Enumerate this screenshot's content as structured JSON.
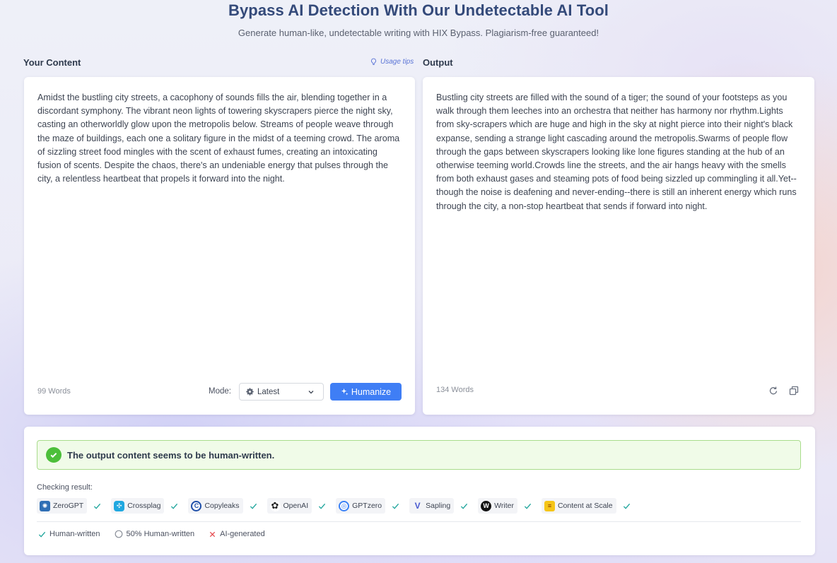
{
  "header": {
    "title": "Bypass AI Detection With Our Undetectable AI Tool",
    "subtitle": "Generate human-like, undetectable writing with HIX Bypass. Plagiarism-free guaranteed!"
  },
  "input": {
    "label": "Your Content",
    "usage_tips": "Usage tips",
    "text": "Amidst the bustling city streets, a cacophony of sounds fills the air, blending together in a discordant symphony. The vibrant neon lights of towering skyscrapers pierce the night sky, casting an otherworldly glow upon the metropolis below. Streams of people weave through the maze of buildings, each one a solitary figure in the midst of a teeming crowd. The aroma of sizzling street food mingles with the scent of exhaust fumes, creating an intoxicating fusion of scents. Despite the chaos, there's an undeniable energy that pulses through the city, a relentless heartbeat that propels it forward into the night.",
    "word_count": "99 Words",
    "mode_label": "Mode:",
    "mode_value": "Latest",
    "humanize_label": "Humanize"
  },
  "output": {
    "label": "Output",
    "text": "Bustling city streets are filled with the sound of a tiger; the sound of your footsteps as you walk through them leeches into an orchestra that neither has harmony nor rhythm.Lights from sky-scrapers which are huge and high in the sky at night pierce into their night's black expanse, sending a strange light cascading around the metropolis.Swarms of people flow through the gaps between skyscrapers looking like lone figures standing at the hub of an otherwise teeming world.Crowds line the streets, and the air hangs heavy with the smells from both exhaust gases and steaming pots of food being sizzled up commingling it all.Yet--though the noise is deafening and never-ending--there is still an inherent energy which runs through the city, a non-stop heartbeat that sends if forward into night.",
    "word_count": "134 Words",
    "icons": [
      "refresh-icon",
      "copy-icon"
    ]
  },
  "results": {
    "banner_text": "The output content seems to be human-written.",
    "checking_label": "Checking result:",
    "detectors": [
      {
        "name": "ZeroGPT",
        "status": "human",
        "color": "#2f6fb5"
      },
      {
        "name": "Crossplag",
        "status": "human",
        "color": "#20a8e0"
      },
      {
        "name": "Copyleaks",
        "status": "human",
        "color": "#1f4fa8"
      },
      {
        "name": "OpenAI",
        "status": "human",
        "color": "#222222"
      },
      {
        "name": "GPTzero",
        "status": "human",
        "color": "#3b82f6"
      },
      {
        "name": "Sapling",
        "status": "human",
        "color": "#4a5bd0"
      },
      {
        "name": "Writer",
        "status": "human",
        "color": "#111111"
      },
      {
        "name": "Content at Scale",
        "status": "human",
        "color": "#f5c518"
      }
    ],
    "legend": {
      "human": "Human-written",
      "half": "50% Human-written",
      "ai": "AI-generated"
    }
  },
  "colors": {
    "accent": "#3f7ef5",
    "success": "#4cbf3a",
    "check": "#1aa39a",
    "ai_red": "#e5484d"
  }
}
